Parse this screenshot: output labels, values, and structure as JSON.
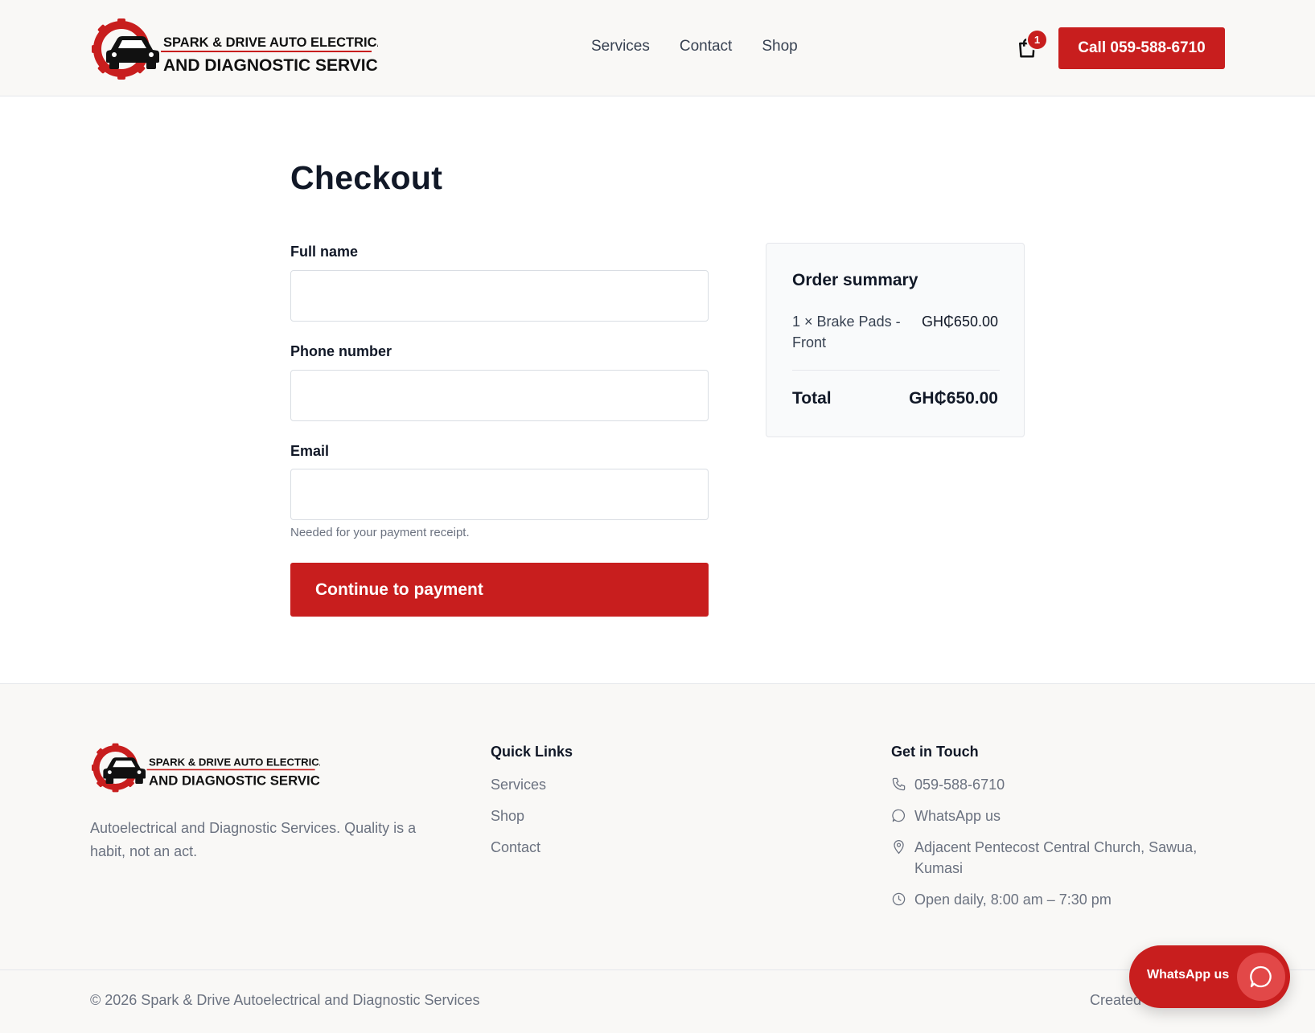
{
  "brand": {
    "logo_line1": "SPARK & DRIVE AUTO ELECTRICAL",
    "logo_line2": "AND DIAGNOSTIC SERVICE"
  },
  "header": {
    "nav": [
      "Services",
      "Contact",
      "Shop"
    ],
    "cart_count": "1",
    "call_label": "Call 059-588-6710"
  },
  "checkout": {
    "title": "Checkout",
    "fields": {
      "full_name_label": "Full name",
      "full_name_value": "",
      "phone_label": "Phone number",
      "phone_value": "",
      "email_label": "Email",
      "email_value": "",
      "email_hint": "Needed for your payment receipt."
    },
    "submit_label": "Continue to payment"
  },
  "summary": {
    "title": "Order summary",
    "items": [
      {
        "name": "1 × Brake Pads - Front",
        "price": "GH₵650.00"
      }
    ],
    "total_label": "Total",
    "total_value": "GH₵650.00"
  },
  "footer": {
    "tagline": "Autoelectrical and Diagnostic Services. Quality is a habit, not an act.",
    "quick_links_heading": "Quick Links",
    "quick_links": [
      "Services",
      "Shop",
      "Contact"
    ],
    "contact_heading": "Get in Touch",
    "contact": {
      "phone": "059-588-6710",
      "whatsapp": "WhatsApp us",
      "address": "Adjacent Pentecost Central Church, Sawua, Kumasi",
      "hours": "Open daily, 8:00 am – 7:30 pm"
    },
    "copyright": "© 2026 Spark & Drive Autoelectrical and Diagnostic Services",
    "created": "Created"
  },
  "floating": {
    "whatsapp_label": "WhatsApp us"
  },
  "colors": {
    "accent": "#c81e1e",
    "page_bg": "#f9f8f6",
    "muted_text": "#6b7280"
  }
}
